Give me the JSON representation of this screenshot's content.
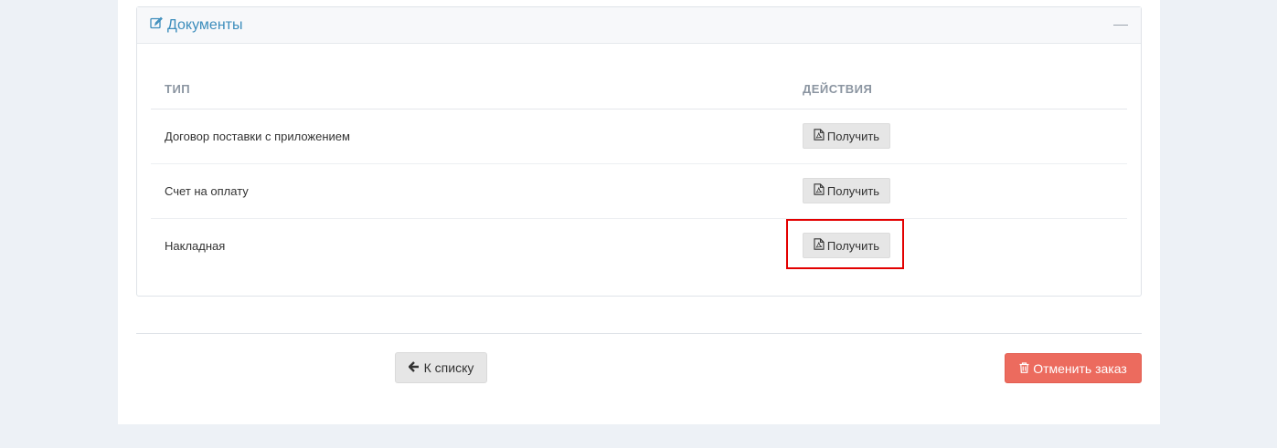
{
  "panel": {
    "title": "Документы",
    "icon": "edit-icon",
    "collapse_icon": "minus-icon"
  },
  "table": {
    "headers": {
      "type": "ТИП",
      "actions": "ДЕЙСТВИЯ"
    },
    "rows": [
      {
        "type": "Договор поставки с приложением",
        "action_label": "Получить"
      },
      {
        "type": "Счет на оплату",
        "action_label": "Получить"
      },
      {
        "type": "Накладная",
        "action_label": "Получить"
      }
    ],
    "action_icon": "file-pdf-icon"
  },
  "footer": {
    "back_label": "К списку",
    "back_icon": "arrow-left-icon",
    "cancel_label": "Отменить заказ",
    "cancel_icon": "trash-icon"
  },
  "colors": {
    "accent": "#3c8dbc",
    "danger": "#ec6b5e",
    "highlight": "#e30000"
  }
}
